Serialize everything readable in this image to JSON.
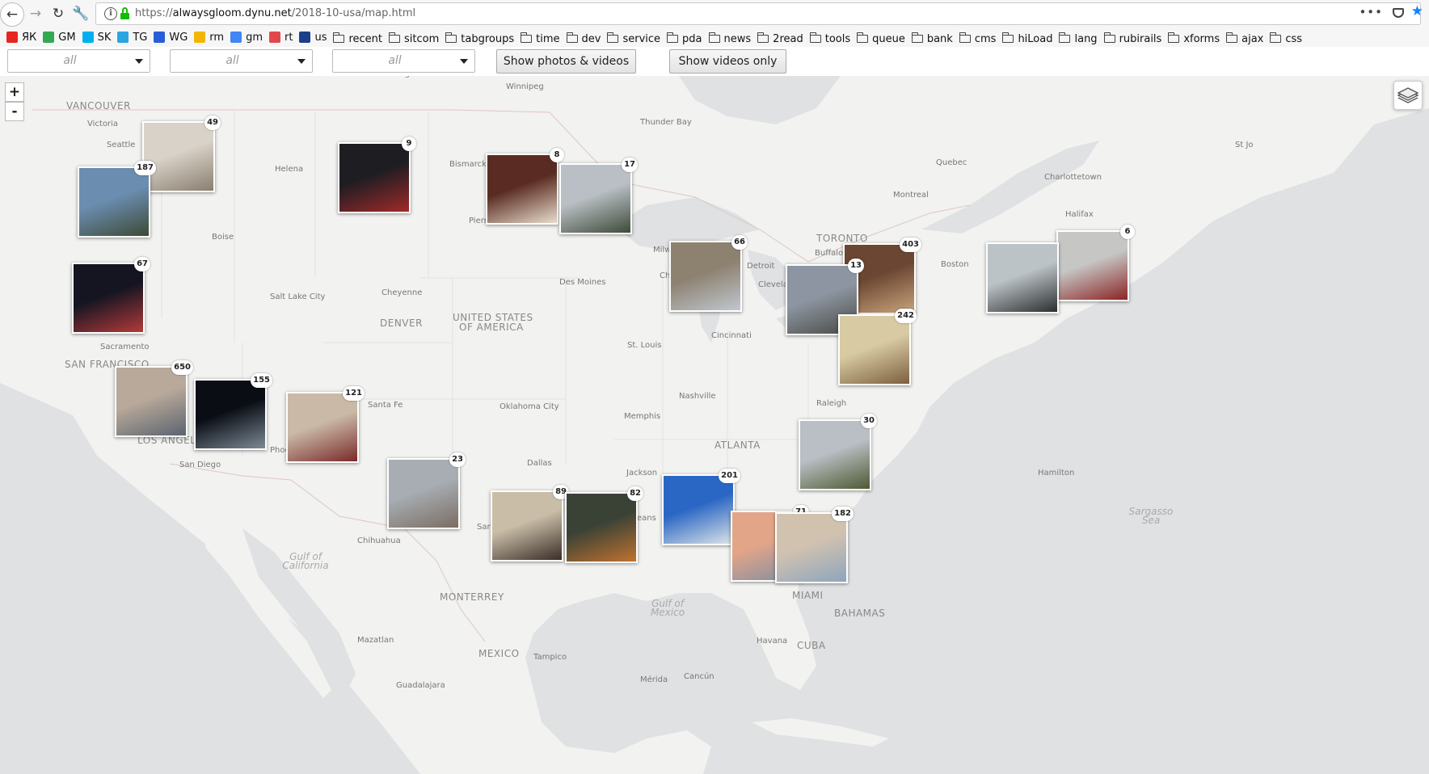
{
  "browser": {
    "url_prefix": "https://",
    "url_host": "alwaysgloom.dynu.net",
    "url_path": "/2018-10-usa/map.html",
    "page_actions": "•••"
  },
  "bookmarks": [
    {
      "label": "ЯК",
      "icon": "yandex-icon",
      "color": "#e52620"
    },
    {
      "label": "GM",
      "icon": "gmail-icon",
      "color": "#34a853"
    },
    {
      "label": "SK",
      "icon": "skype-icon",
      "color": "#00aff0"
    },
    {
      "label": "TG",
      "icon": "telegram-icon",
      "color": "#2ca5e0"
    },
    {
      "label": "WG",
      "icon": "wg-icon",
      "color": "#2760d6"
    },
    {
      "label": "rm",
      "icon": "circle-icon",
      "color": "#f2b600"
    },
    {
      "label": "gm",
      "icon": "google-icon",
      "color": "#4285f4"
    },
    {
      "label": "rt",
      "icon": "pinwheel-icon",
      "color": "#e0484e"
    },
    {
      "label": "us",
      "icon": "usa-icon",
      "color": "#1b3f8b"
    },
    {
      "label": "recent",
      "icon": "folder-icon"
    },
    {
      "label": "sitcom",
      "icon": "folder-icon"
    },
    {
      "label": "tabgroups",
      "icon": "folder-icon"
    },
    {
      "label": "time",
      "icon": "folder-icon"
    },
    {
      "label": "dev",
      "icon": "folder-icon"
    },
    {
      "label": "service",
      "icon": "folder-icon"
    },
    {
      "label": "pda",
      "icon": "folder-icon"
    },
    {
      "label": "news",
      "icon": "folder-icon"
    },
    {
      "label": "2read",
      "icon": "folder-icon"
    },
    {
      "label": "tools",
      "icon": "folder-icon"
    },
    {
      "label": "queue",
      "icon": "folder-icon"
    },
    {
      "label": "bank",
      "icon": "folder-icon"
    },
    {
      "label": "cms",
      "icon": "folder-icon"
    },
    {
      "label": "hiLoad",
      "icon": "folder-icon"
    },
    {
      "label": "lang",
      "icon": "folder-icon"
    },
    {
      "label": "rubirails",
      "icon": "folder-icon"
    },
    {
      "label": "xforms",
      "icon": "folder-icon"
    },
    {
      "label": "ajax",
      "icon": "folder-icon"
    },
    {
      "label": "css",
      "icon": "folder-icon"
    }
  ],
  "filters": {
    "select1": "all",
    "select2": "all",
    "select3": "all",
    "photos_videos_label": "Show photos & videos",
    "videos_only_label": "Show videos only"
  },
  "map": {
    "zoom_in": "+",
    "zoom_out": "-",
    "country_us": [
      "UNITED STATES",
      "OF AMERICA"
    ],
    "labels": [
      "VANCOUVER",
      "Victoria",
      "Seattle",
      "Regina",
      "Winnipeg",
      "Thunder Bay",
      "Quebec",
      "Charlottetown",
      "St Jo",
      "Halifax",
      "Montreal",
      "Helena",
      "Bismarck",
      "Pierr",
      "Boise",
      "Salt Lake City",
      "Cheyenne",
      "DENVER",
      "Des Moines",
      "Milw",
      "TORONTO",
      "Buffalo",
      "Detroit",
      "Clevela",
      "Ch",
      "Boston",
      "Sacramento",
      "SAN FRANCISCO",
      "St. Louis",
      "Cincinnati",
      "Santa Fe",
      "Oklahoma City",
      "Memphis",
      "Nashville",
      "Raleigh",
      "LOS ANGELE",
      "San Diego",
      "Phoe",
      "ATLANTA",
      "Dallas",
      "Jackson",
      "Hamilton",
      "San",
      "eans",
      "Chihuahua",
      "MONTERREY",
      "MIAMI",
      "BAHAMAS",
      "Mazatlan",
      "MEXICO",
      "Tampico",
      "Havana",
      "CUBA",
      "Cancún",
      "Mérida",
      "Guadalajara"
    ],
    "seas": [
      "Gulf of California",
      "Gulf of Mexico",
      "Sargasso Sea"
    ]
  },
  "clusters": [
    {
      "count": "49",
      "colors": [
        "#d9d2c8",
        "#8a7f70"
      ]
    },
    {
      "count": "187",
      "colors": [
        "#6b8db0",
        "#3c4a36"
      ]
    },
    {
      "count": "9",
      "colors": [
        "#1d1d22",
        "#a02a2a"
      ]
    },
    {
      "count": "8",
      "colors": [
        "#5a2b22",
        "#e8dccb"
      ]
    },
    {
      "count": "17",
      "colors": [
        "#b9bfc4",
        "#3e4a3a"
      ]
    },
    {
      "count": "67",
      "colors": [
        "#141521",
        "#b43a3a"
      ]
    },
    {
      "count": "66",
      "colors": [
        "#8d8170",
        "#bfc7cf"
      ]
    },
    {
      "count": "403",
      "colors": [
        "#6b4632",
        "#c9a37c"
      ]
    },
    {
      "count": "13",
      "colors": [
        "#8c95a1",
        "#4a4a45"
      ]
    },
    {
      "count": "242",
      "colors": [
        "#d8cba3",
        "#7d5f3f"
      ]
    },
    {
      "count": "6",
      "colors": [
        "#c6c7c5",
        "#8b2424"
      ]
    },
    {
      "count": "",
      "colors": [
        "#bcc3c7",
        "#2c2f2f"
      ]
    },
    {
      "count": "650",
      "colors": [
        "#b9a99a",
        "#5b6470"
      ]
    },
    {
      "count": "155",
      "colors": [
        "#0a0d14",
        "#7c8a96"
      ]
    },
    {
      "count": "121",
      "colors": [
        "#c9b9a6",
        "#7a2a2a"
      ]
    },
    {
      "count": "23",
      "colors": [
        "#a7adb2",
        "#7b6d63"
      ]
    },
    {
      "count": "30",
      "colors": [
        "#b9bfc4",
        "#4d5a33"
      ]
    },
    {
      "count": "201",
      "colors": [
        "#2a67c4",
        "#dde4e6"
      ]
    },
    {
      "count": "89",
      "colors": [
        "#c9bda8",
        "#3a2e27"
      ]
    },
    {
      "count": "82",
      "colors": [
        "#3a4236",
        "#c0722f"
      ]
    },
    {
      "count": "71",
      "colors": [
        "#e3a588",
        "#7d8ea3"
      ]
    },
    {
      "count": "182",
      "colors": [
        "#d1c2b0",
        "#8ea5bd"
      ]
    }
  ]
}
